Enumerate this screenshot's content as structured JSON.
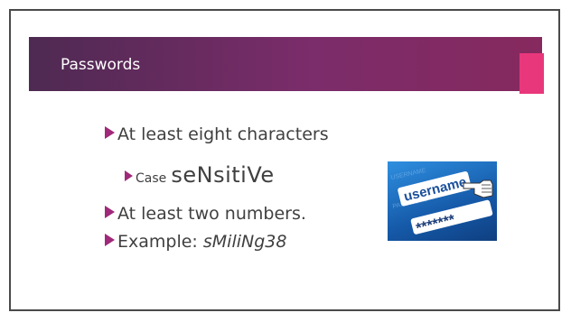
{
  "slide": {
    "title": "Passwords",
    "bullets": {
      "line1": "At least eight characters",
      "case_label": "Case",
      "case_value": "seNsitiVe",
      "line3": "At least two numbers.",
      "example_label": "Example: ",
      "example_value": "sMiliNg38"
    }
  },
  "image": {
    "word_username": "username",
    "word_password_mask": "*******",
    "faint_label_username": "USERNAME",
    "faint_label_password": "PASSWORD"
  },
  "colors": {
    "title_bar_start": "#4e2a52",
    "title_bar_end": "#86295e",
    "accent_tab": "#e9377b",
    "bullet_marker": "#a0297a",
    "text": "#404040"
  }
}
